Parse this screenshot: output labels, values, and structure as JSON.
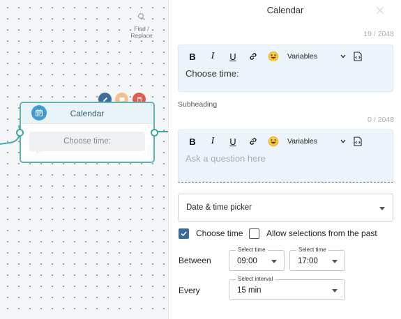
{
  "canvas": {
    "find_replace_label": "Find / Replace",
    "node": {
      "title": "Calendar",
      "body": "Choose time:"
    }
  },
  "panel": {
    "title": "Calendar",
    "question_counter": "19 / 2048",
    "question_text": "Choose time:",
    "subheading_label": "Subheading",
    "subheading_counter": "0 / 2048",
    "subheading_placeholder": "Ask a question here",
    "toolbar": {
      "variables_label": "Variables"
    },
    "picker_type": "Date & time picker",
    "choose_time": {
      "label": "Choose time",
      "checked": true
    },
    "allow_past": {
      "label": "Allow selections from the past",
      "checked": false
    },
    "between": {
      "label": "Between",
      "start": {
        "label": "Select time",
        "value": "09:00"
      },
      "end": {
        "label": "Select time",
        "value": "17:00"
      }
    },
    "every": {
      "label": "Every",
      "interval": {
        "label": "Select interval",
        "value": "15 min"
      }
    }
  },
  "colors": {
    "node_border": "#5eb3b0",
    "checkbox_accent": "#3b6a98",
    "editor_bg": "#eef4fb",
    "delete": "#e25b4f",
    "edit": "#3e6d99",
    "comment": "#f2c18d"
  }
}
